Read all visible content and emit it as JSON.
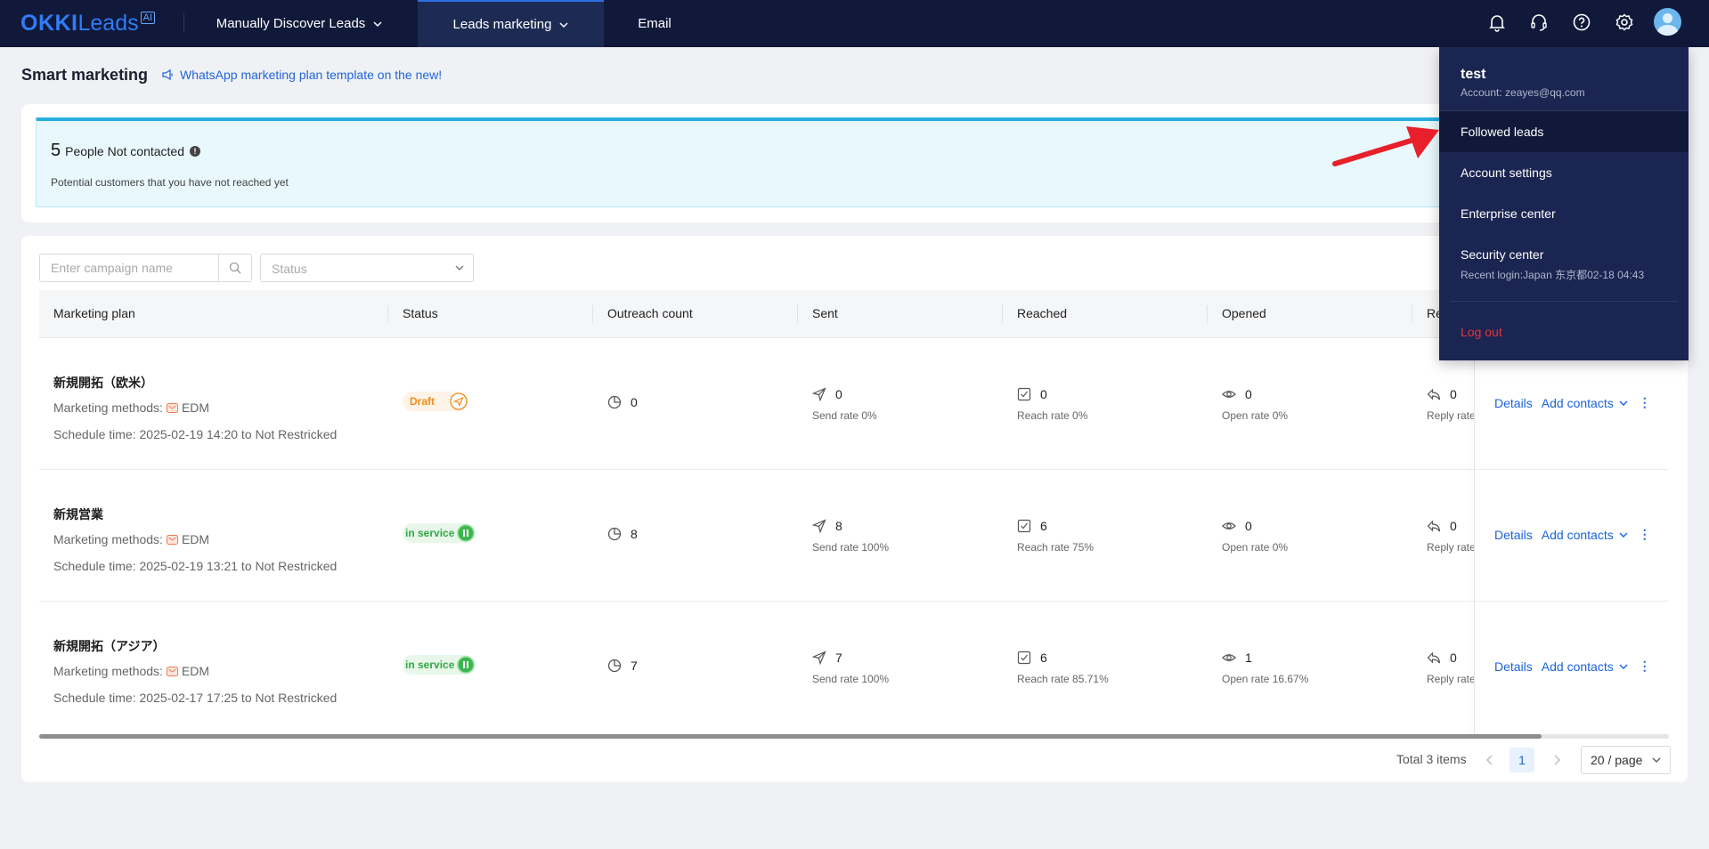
{
  "header": {
    "logo_text": "OKKI",
    "logo_leads": "Leads",
    "logo_ai": "AI",
    "nav": [
      {
        "label": "Manually Discover Leads"
      },
      {
        "label": "Leads marketing"
      },
      {
        "label": "Email"
      }
    ],
    "icons": [
      "bell-icon",
      "headset-icon",
      "help-icon",
      "settings-icon",
      "avatar"
    ]
  },
  "page": {
    "title": "Smart marketing",
    "promo": "WhatsApp marketing plan template on the new!"
  },
  "summary": {
    "count": "5",
    "label": "People Not contacted",
    "info": "!",
    "description": "Potential customers that you have not reached yet"
  },
  "filters": {
    "search_placeholder": "Enter campaign name",
    "status_placeholder": "Status"
  },
  "table": {
    "columns": [
      "Marketing plan",
      "Status",
      "Outreach count",
      "Sent",
      "Reached",
      "Opened",
      "Re"
    ],
    "rows": [
      {
        "name": "新規開拓（欧米）",
        "methods_label": "Marketing methods:",
        "method": "EDM",
        "schedule": "Schedule time: 2025-02-19 14:20 to Not Restricked",
        "status": "Draft",
        "outreach": "0",
        "sent": "0",
        "send_rate": "Send rate 0%",
        "reached": "0",
        "reach_rate": "Reach rate 0%",
        "opened": "0",
        "open_rate": "Open rate 0%",
        "replied": "0",
        "reply_rate": "Reply rate"
      },
      {
        "name": "新規営業",
        "methods_label": "Marketing methods:",
        "method": "EDM",
        "schedule": "Schedule time: 2025-02-19 13:21 to Not Restricked",
        "status": "in service",
        "outreach": "8",
        "sent": "8",
        "send_rate": "Send rate 100%",
        "reached": "6",
        "reach_rate": "Reach rate 75%",
        "opened": "0",
        "open_rate": "Open rate 0%",
        "replied": "0",
        "reply_rate": "Reply rate"
      },
      {
        "name": "新規開拓（アジア）",
        "methods_label": "Marketing methods:",
        "method": "EDM",
        "schedule": "Schedule time: 2025-02-17 17:25 to Not Restricked",
        "status": "in service",
        "outreach": "7",
        "sent": "7",
        "send_rate": "Send rate 100%",
        "reached": "6",
        "reach_rate": "Reach rate 85.71%",
        "opened": "1",
        "open_rate": "Open rate 16.67%",
        "replied": "0",
        "reply_rate": "Reply rate"
      }
    ],
    "actions": {
      "details": "Details",
      "add_contacts": "Add contacts",
      "more": "⋮"
    }
  },
  "pagination": {
    "total": "Total 3 items",
    "current": "1",
    "page_size": "20 / page"
  },
  "user_menu": {
    "name": "test",
    "account": "Account: zeayes@qq.com",
    "items": [
      "Followed leads",
      "Account settings",
      "Enterprise center"
    ],
    "security": "Security center",
    "recent_login": "Recent login:Japan 东京都02-18 04:43",
    "logout": "Log out"
  },
  "colors": {
    "topbar": "#11193a",
    "menu_bg": "#1b2551",
    "accent": "#2f7cf6",
    "link": "#1a62d8",
    "logout": "#e8333b",
    "draft": "#f08c1c",
    "in_service": "#33a845",
    "summary_border": "#27aee0"
  }
}
